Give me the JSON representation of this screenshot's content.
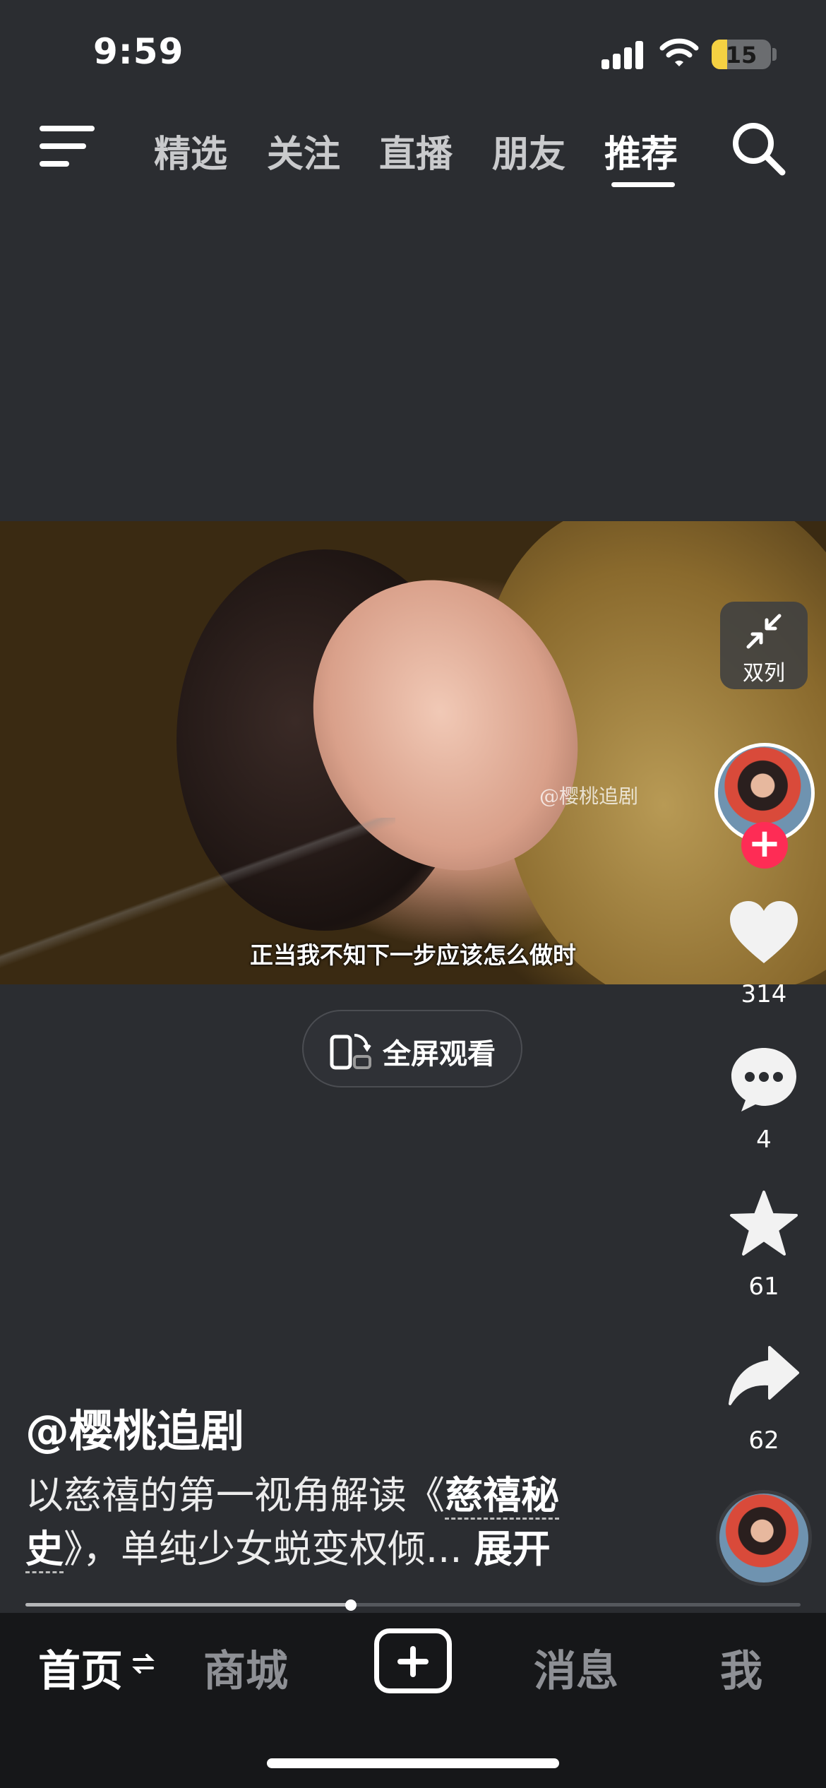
{
  "status_bar": {
    "time": "9:59",
    "battery": "15"
  },
  "top_nav": {
    "tabs": [
      {
        "label": "精选",
        "active": false
      },
      {
        "label": "关注",
        "active": false
      },
      {
        "label": "直播",
        "active": false
      },
      {
        "label": "朋友",
        "active": false
      },
      {
        "label": "推荐",
        "active": true
      }
    ]
  },
  "video": {
    "watermark": "@樱桃追剧",
    "subtitle": "正当我不知下一步应该怎么做时",
    "fullscreen_label": "全屏观看",
    "progress": 0.42
  },
  "sidebar": {
    "double_column_label": "双列",
    "likes": "314",
    "comments": "4",
    "favorites": "61",
    "shares": "62"
  },
  "caption": {
    "author": "@樱桃追剧",
    "text_before": "以慈禧的第一视角解读",
    "open_quote": "《",
    "title_link": "慈禧秘史",
    "text_after": "》，单纯少女蜕变权倾...",
    "more": "展开"
  },
  "bottom_nav": {
    "home": "首页",
    "mall": "商城",
    "messages": "消息",
    "me": "我"
  },
  "colors": {
    "background": "#2b2d31",
    "accent": "#fe2c55",
    "bottom_bar": "#161719"
  }
}
